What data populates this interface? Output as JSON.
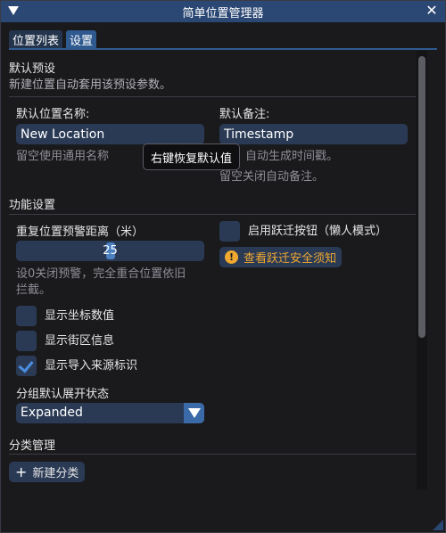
{
  "window": {
    "title": "简单位置管理器",
    "close_glyph": "✕"
  },
  "tabs": [
    {
      "label": "位置列表",
      "active": false
    },
    {
      "label": "设置",
      "active": true
    }
  ],
  "defaults": {
    "section_title": "默认预设",
    "description": "新建位置自动套用该预设参数。",
    "name_label": "默认位置名称:",
    "name_value": "New Location",
    "name_hint": "留空使用通用名称",
    "note_label": "默认备注:",
    "note_value": "Timestamp",
    "note_hint_line1": "自动生成时间戳。",
    "note_hint_line2": "留空关闭自动备注。",
    "tooltip": "右键恢复默认值"
  },
  "features": {
    "section_title": "功能设置",
    "dup_distance_label": "重复位置预警距离（米）",
    "dup_distance_value": 25,
    "dup_distance_hint_line1": "设0关闭预警，完全重合位置依旧",
    "dup_distance_hint_line2": "拦截。",
    "jump_button_label": "启用跃迁按钮（懒人模式）",
    "jump_button_checked": false,
    "jump_safety_label": "查看跃迁安全须知",
    "show_coords_label": "显示坐标数值",
    "show_coords_checked": false,
    "show_district_label": "显示街区信息",
    "show_district_checked": false,
    "show_import_label": "显示导入来源标识",
    "show_import_checked": true,
    "group_state_label": "分组默认展开状态",
    "group_state_value": "Expanded"
  },
  "categories": {
    "section_title": "分类管理",
    "add_label": "新建分类",
    "add_glyph": "+"
  },
  "colors": {
    "title_bar": "#2b4773",
    "field_bg": "#2a3a55",
    "accent": "#4a8de0",
    "warning": "#f0a830"
  }
}
